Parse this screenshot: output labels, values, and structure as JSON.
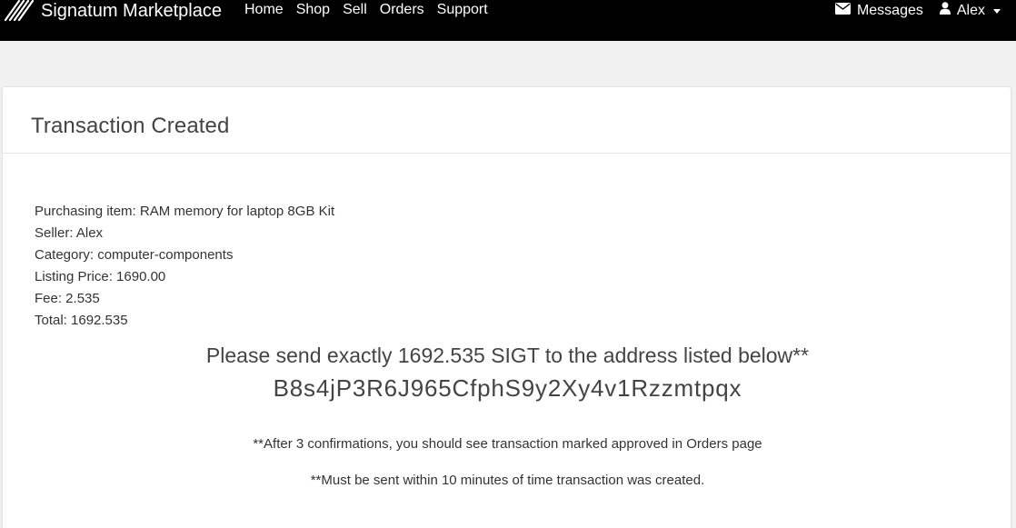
{
  "navbar": {
    "brand": "Signatum Marketplace",
    "links": [
      "Home",
      "Shop",
      "Sell",
      "Orders",
      "Support"
    ],
    "messages_label": "Messages",
    "user_label": "Alex"
  },
  "panel": {
    "title": "Transaction Created",
    "details": {
      "item": "Purchasing item: RAM memory for laptop 8GB Kit",
      "seller": "Seller: Alex",
      "category": "Category: computer-components",
      "listing_price": "Listing Price: 1690.00",
      "fee": "Fee: 2.535",
      "total": "Total: 1692.535"
    },
    "instruction": "Please send exactly 1692.535 SIGT to the address listed below**",
    "address": "B8s4jP3R6J965CfphS9y2Xy4v1Rzzmtpqx",
    "note_confirmations": "**After 3 confirmations, you should see transaction marked approved in Orders page",
    "note_time_limit": "**Must be sent within 10 minutes of time transaction was created."
  },
  "colors": {
    "navbar_bg": "#000000",
    "page_bg": "#f1f1f1",
    "panel_bg": "#ffffff",
    "text": "#333333"
  },
  "icons": {
    "brand": "diagonal-stripes-logo-icon",
    "messages": "envelope-icon",
    "user": "user-icon",
    "dropdown": "caret-down-icon"
  }
}
